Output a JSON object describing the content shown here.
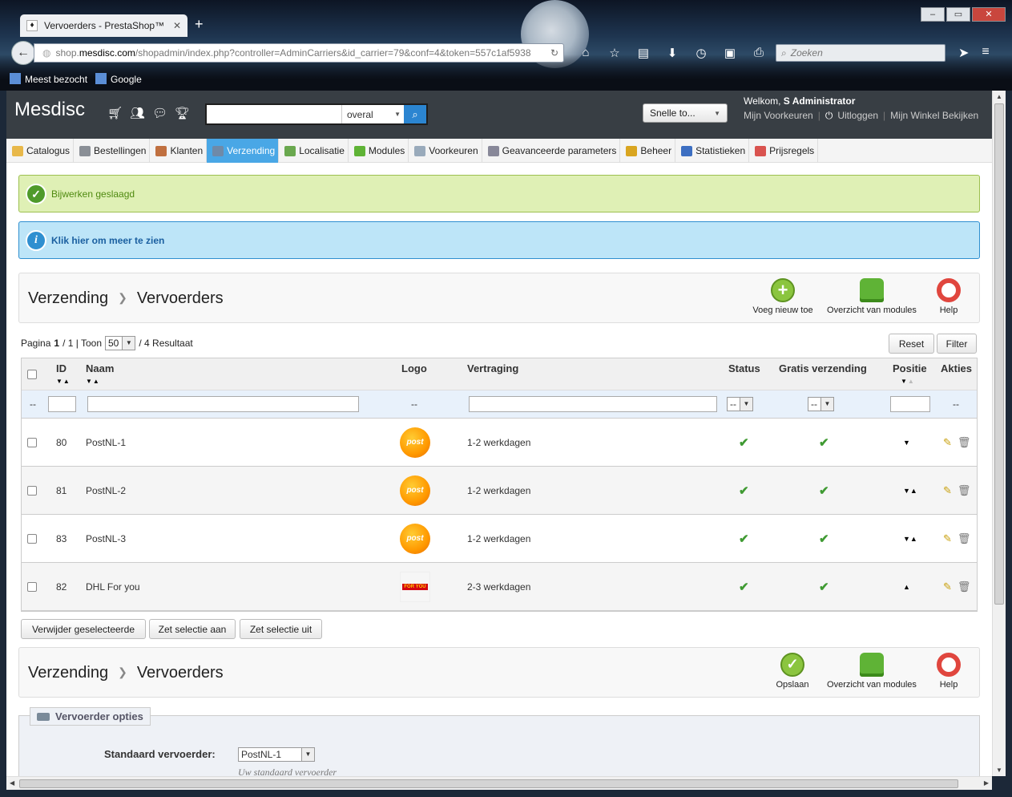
{
  "browser": {
    "tab_title": "Vervoerders - PrestaShop™",
    "tab_close": "✕",
    "new_tab": "+",
    "url_prefix": "shop.",
    "url_domain": "mesdisc.com",
    "url_rest": "/shopadmin/index.php?controller=AdminCarriers&id_carrier=79&conf=4&token=557c1af5938",
    "search_placeholder": "Zoeken",
    "bookmarks": [
      "Meest bezocht",
      "Google"
    ],
    "window_buttons": [
      "–",
      "▭",
      "✕"
    ]
  },
  "header": {
    "brand": "Mesdisc",
    "search_scope": "overal",
    "quick_access": "Snelle to...",
    "welcome": "Welkom, ",
    "employee": "S Administrator",
    "links": [
      "Mijn Voorkeuren",
      "Uitloggen",
      "Mijn Winkel Bekijken"
    ]
  },
  "menu": [
    {
      "label": "Catalogus",
      "icon": "folder-icon",
      "color": "#e8b84a"
    },
    {
      "label": "Bestellingen",
      "icon": "cart-icon",
      "color": "#8a8f96"
    },
    {
      "label": "Klanten",
      "icon": "customer-icon",
      "color": "#c07040"
    },
    {
      "label": "Verzending",
      "icon": "truck-icon",
      "color": "#6f8aa8",
      "active": true
    },
    {
      "label": "Localisatie",
      "icon": "globe-icon",
      "color": "#6aa84f"
    },
    {
      "label": "Modules",
      "icon": "puzzle-icon",
      "color": "#5fb336"
    },
    {
      "label": "Voorkeuren",
      "icon": "preferences-icon",
      "color": "#9ab"
    },
    {
      "label": "Geavanceerde parameters",
      "icon": "wrench-icon",
      "color": "#889"
    },
    {
      "label": "Beheer",
      "icon": "key-icon",
      "color": "#d9a520"
    },
    {
      "label": "Statistieken",
      "icon": "chart-icon",
      "color": "#3d6fc2"
    },
    {
      "label": "Prijsregels",
      "icon": "price-rules-icon",
      "color": "#d9534f"
    }
  ],
  "alerts": {
    "success": "Bijwerken geslaagd",
    "info": "Klik hier om meer te zien"
  },
  "toolbar_top": {
    "crumb_1": "Verzending",
    "crumb_2": "Vervoerders",
    "buttons": [
      "Voeg nieuw toe",
      "Overzicht van modules",
      "Help"
    ]
  },
  "list": {
    "pagination": {
      "pagina": "Pagina",
      "page": "1",
      "of": "/ 1 | Toon",
      "per_page": "50",
      "results": "/ 4 Resultaat"
    },
    "reset": "Reset",
    "filter": "Filter",
    "columns": [
      "ID",
      "Naam",
      "Logo",
      "Vertraging",
      "Status",
      "Gratis verzending",
      "Positie",
      "Akties"
    ],
    "filter_placeholders": {
      "dash": "--",
      "status": "--",
      "free": "--"
    },
    "rows": [
      {
        "id": "80",
        "name": "PostNL-1",
        "logo": "postnl",
        "delay": "1-2 werkdagen",
        "position": "down"
      },
      {
        "id": "81",
        "name": "PostNL-2",
        "logo": "postnl",
        "delay": "1-2 werkdagen",
        "position": "both"
      },
      {
        "id": "83",
        "name": "PostNL-3",
        "logo": "postnl",
        "delay": "1-2 werkdagen",
        "position": "both"
      },
      {
        "id": "82",
        "name": "DHL For you",
        "logo": "dhl",
        "delay": "2-3 werkdagen",
        "position": "up"
      }
    ],
    "bulk": [
      "Verwijder geselecteerde",
      "Zet selectie aan",
      "Zet selectie uit"
    ]
  },
  "toolbar_bottom": {
    "crumb_1": "Verzending",
    "crumb_2": "Vervoerders",
    "buttons": [
      "Opslaan",
      "Overzicht van modules",
      "Help"
    ]
  },
  "options": {
    "legend": "Vervoerder opties",
    "label": "Standaard vervoerder:",
    "value": "PostNL-1",
    "hint": "Uw standaard vervoerder"
  }
}
